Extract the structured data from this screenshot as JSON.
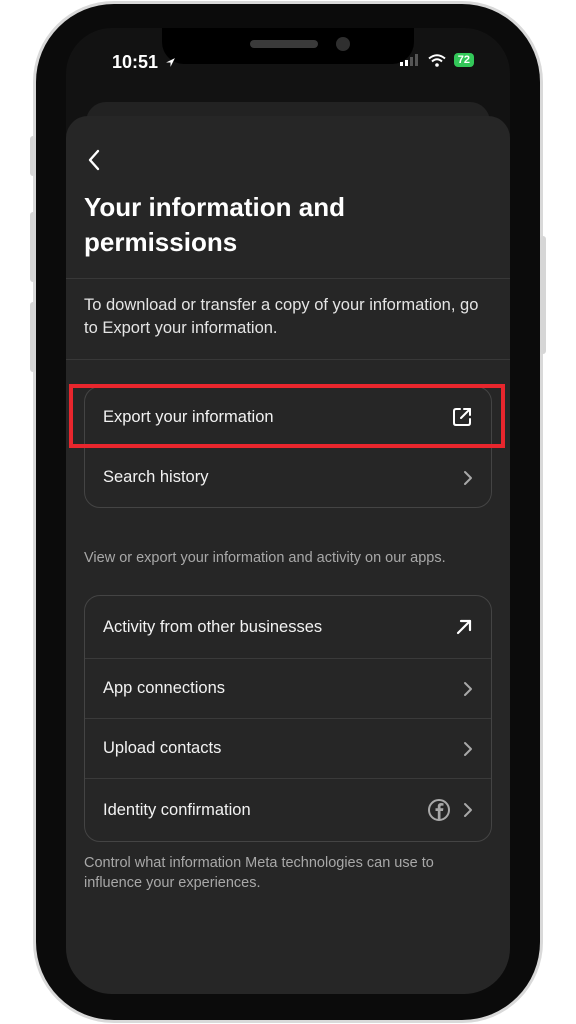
{
  "status_bar": {
    "time": "10:51",
    "battery": "72"
  },
  "header": {
    "title": "Your information and permissions"
  },
  "intro_text": "To download or transfer a copy of your information, go to Export your information.",
  "group1": {
    "items": [
      {
        "label": "Export your information",
        "icon": "external-link-icon"
      },
      {
        "label": "Search history",
        "icon": "chevron-right-icon"
      }
    ],
    "helper": "View or export your information and activity on our apps."
  },
  "group2": {
    "items": [
      {
        "label": "Activity from other businesses",
        "icon": "arrow-up-right-icon"
      },
      {
        "label": "App connections",
        "icon": "chevron-right-icon"
      },
      {
        "label": "Upload contacts",
        "icon": "chevron-right-icon"
      },
      {
        "label": "Identity confirmation",
        "icon": "facebook-icon"
      }
    ],
    "helper": "Control what information Meta technologies can use to influence your experiences."
  },
  "colors": {
    "highlight": "#e8262d",
    "sheet_bg": "#262626",
    "battery": "#33c759"
  }
}
